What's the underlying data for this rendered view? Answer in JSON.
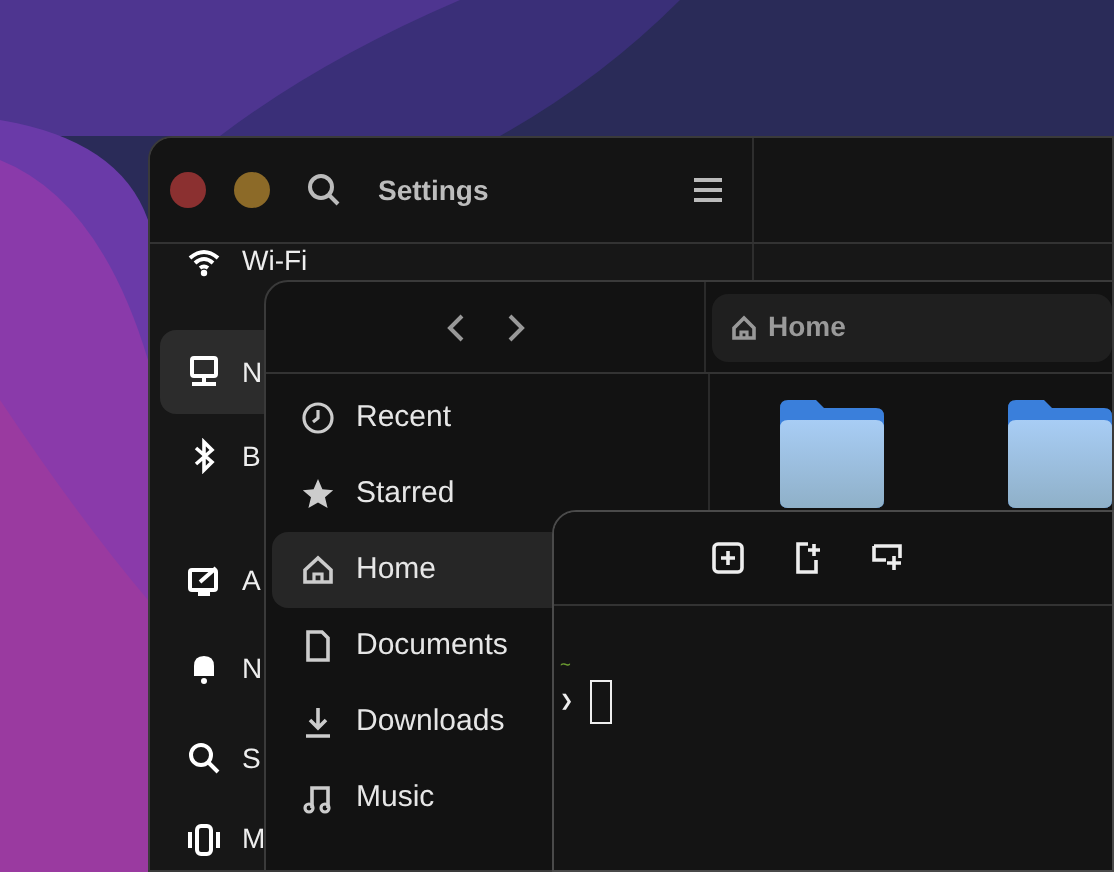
{
  "settings": {
    "title": "Settings",
    "window_buttons": [
      {
        "kind": "close"
      },
      {
        "kind": "minimize"
      }
    ],
    "sidebar": [
      {
        "label": "Wi-Fi",
        "selected": false
      },
      {
        "label": "N",
        "selected": true
      },
      {
        "label": "B",
        "selected": false
      },
      {
        "label": "A",
        "selected": false
      },
      {
        "label": "N",
        "selected": false
      },
      {
        "label": "S",
        "selected": false
      },
      {
        "label": "M",
        "selected": false
      }
    ]
  },
  "files": {
    "path": "Home",
    "sidebar": [
      {
        "label": "Recent",
        "selected": false
      },
      {
        "label": "Starred",
        "selected": false
      },
      {
        "label": "Home",
        "selected": true
      },
      {
        "label": "Documents",
        "selected": false
      },
      {
        "label": "Downloads",
        "selected": false
      },
      {
        "label": "Music",
        "selected": false
      }
    ],
    "folders": [
      {
        "kind": "folder"
      },
      {
        "kind": "folder"
      }
    ]
  },
  "terminal": {
    "cwd": "~",
    "prompt": "❯"
  }
}
